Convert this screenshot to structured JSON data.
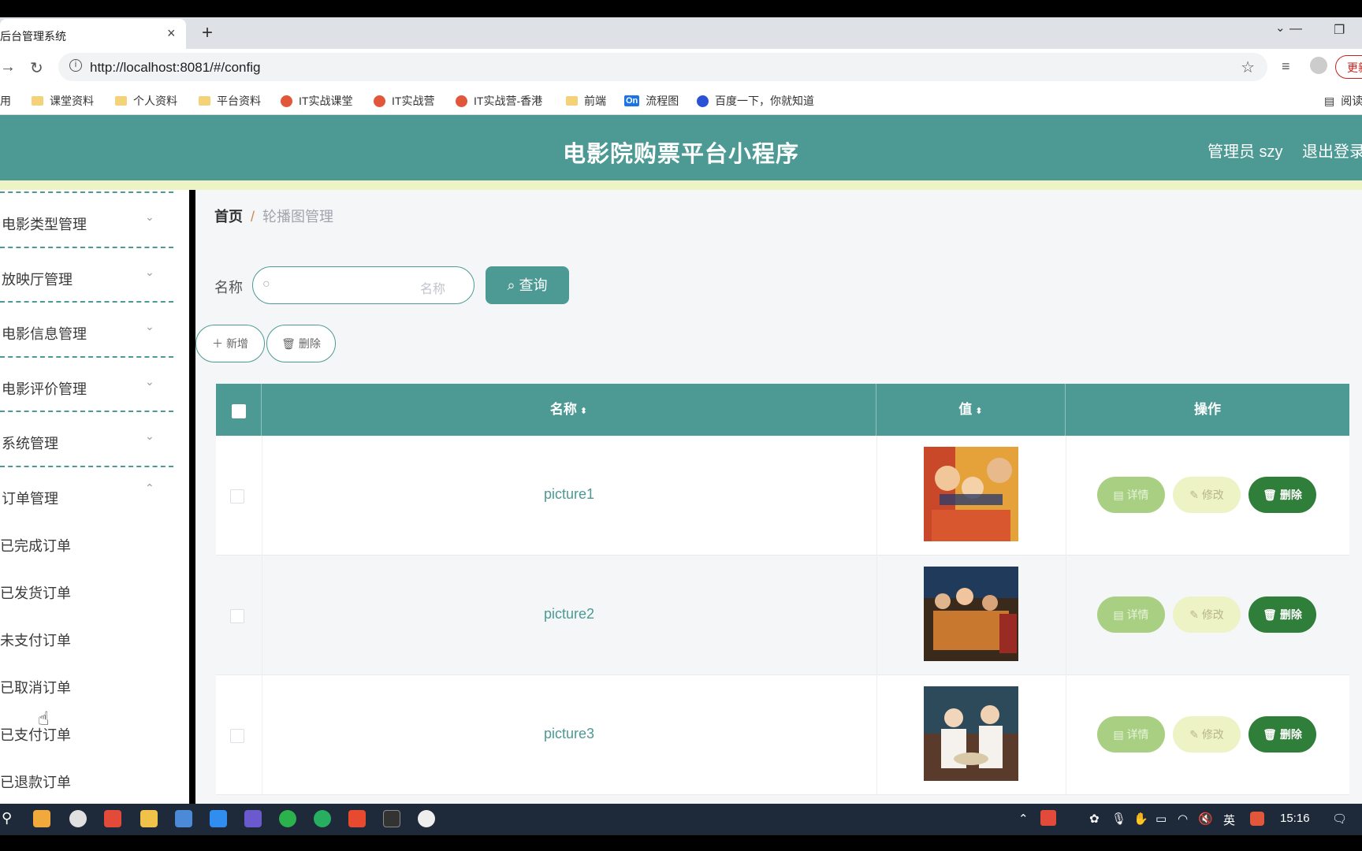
{
  "browser": {
    "tab_title": "后台管理系统",
    "tab_close": "×",
    "new_tab": "+",
    "url": "http://localhost:8081/#/config",
    "update_label": "更新",
    "bookmarks": [
      "用",
      "课堂资料",
      "个人资料",
      "平台资料",
      "IT实战课堂",
      "IT实战营",
      "IT实战营-香港",
      "前端",
      "流程图",
      "百度一下，你就知道",
      "阅读"
    ],
    "bookmark_badge": "On"
  },
  "header": {
    "title": "电影院购票平台小程序",
    "admin": "管理员 szy",
    "logout": "退出登录"
  },
  "sidebar": {
    "groups": [
      "电影类型管理",
      "放映厅管理",
      "电影信息管理",
      "电影评价管理",
      "系统管理",
      "订单管理"
    ],
    "order_items": [
      "已完成订单",
      "已发货订单",
      "未支付订单",
      "已取消订单",
      "已支付订单",
      "已退款订单"
    ]
  },
  "breadcrumb": {
    "home": "首页",
    "separator": "/",
    "current": "轮播图管理"
  },
  "search": {
    "label": "名称",
    "placeholder": "名称",
    "query_button": "查询"
  },
  "actions": {
    "add": "新增",
    "delete": "删除"
  },
  "table": {
    "headers": {
      "name": "名称",
      "value": "值",
      "ops": "操作"
    },
    "rows": [
      {
        "name": "picture1"
      },
      {
        "name": "picture2"
      },
      {
        "name": "picture3"
      }
    ],
    "row_actions": {
      "detail": "详情",
      "edit": "修改",
      "delete": "删除"
    }
  },
  "taskbar": {
    "ime": "英",
    "clock": "15:16"
  },
  "colors": {
    "primary": "#4c9a93",
    "detail_btn": "#a9cf82",
    "edit_btn": "#eef3c6",
    "delete_btn": "#2f7e39"
  }
}
